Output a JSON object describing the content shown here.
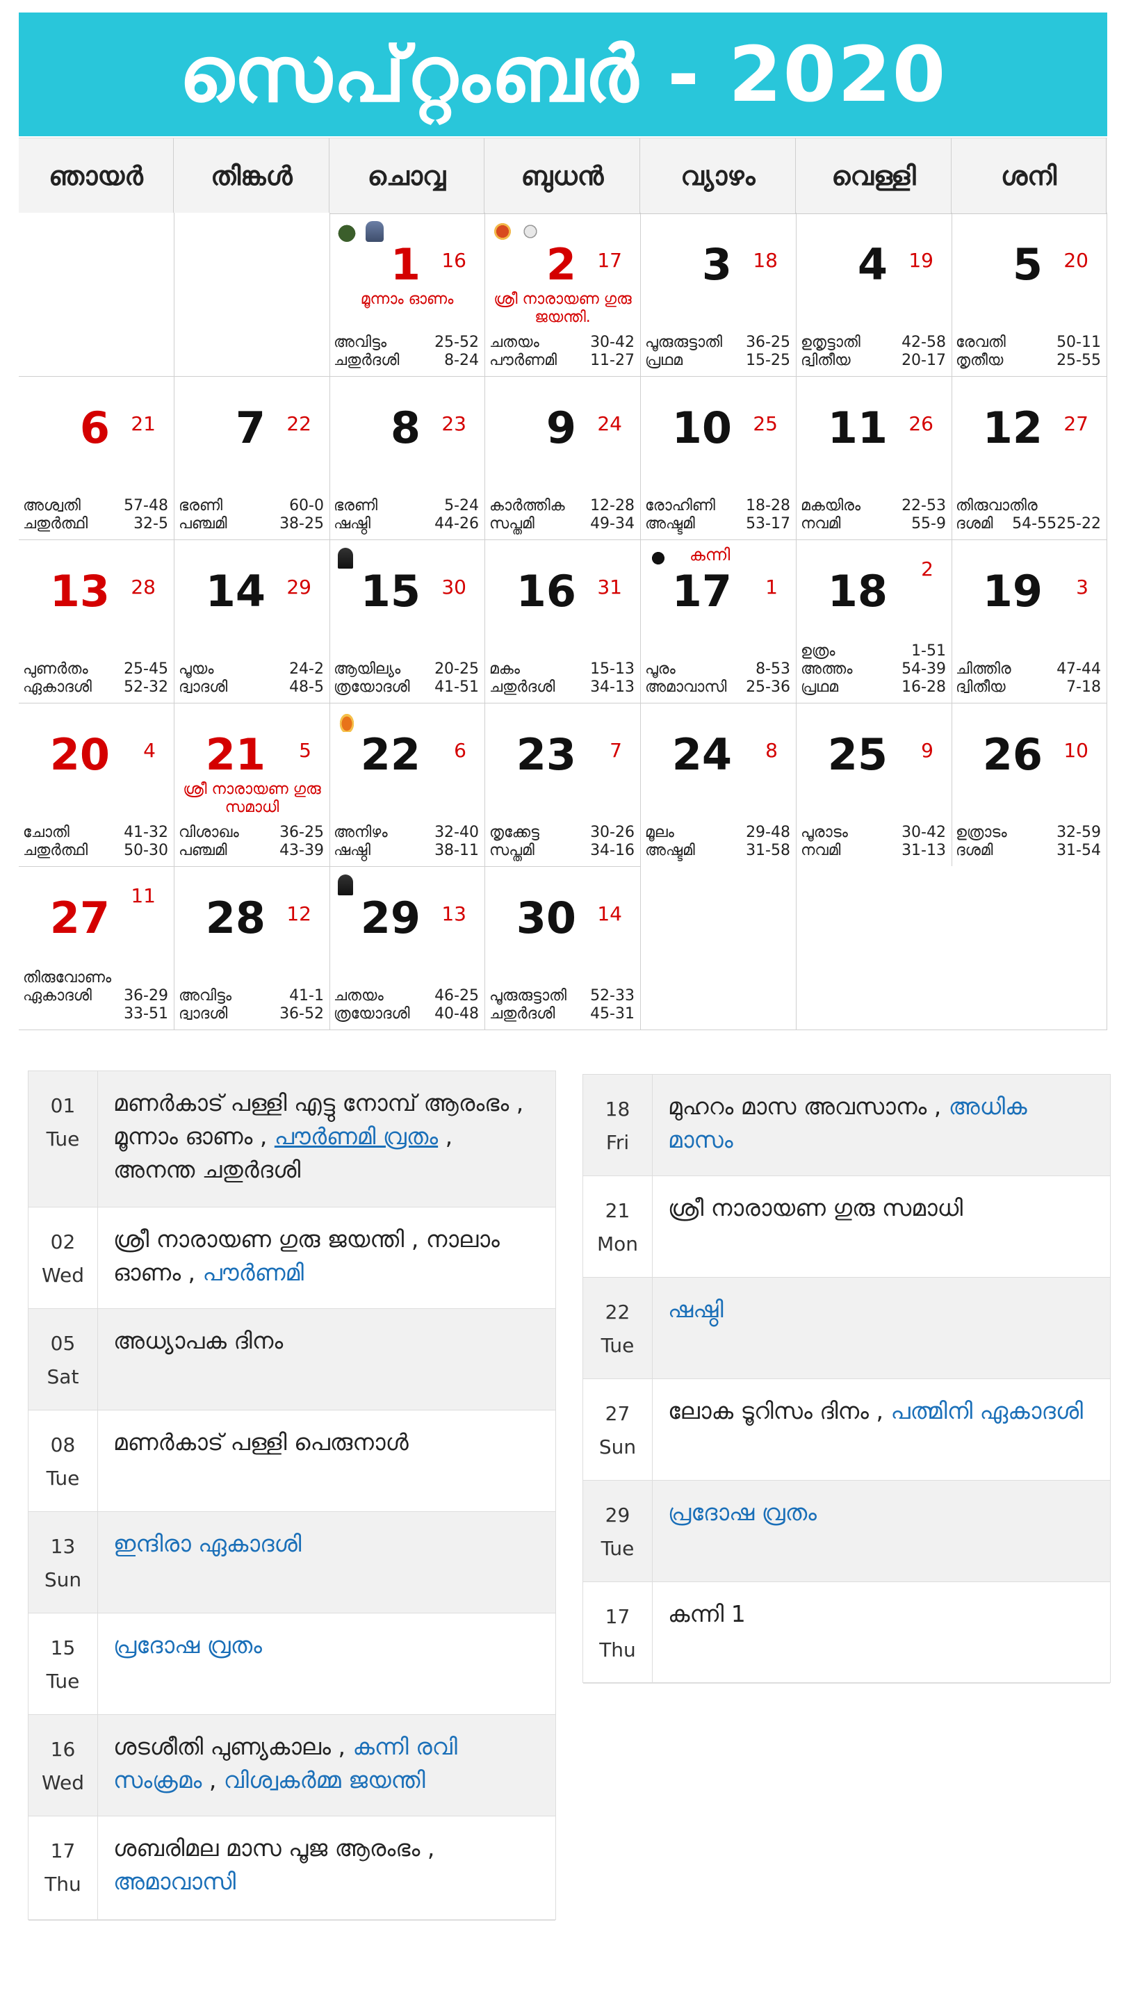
{
  "title": "സെപ്റ്റംബർ - 2020",
  "weekdays": [
    "ഞായർ",
    "തിങ്കൾ",
    "ചൊവ്വ",
    "ബുധൻ",
    "വ്യാഴം",
    "വെള്ളി",
    "ശനി"
  ],
  "days": [
    {
      "d": "1",
      "m": "16",
      "red": true,
      "fest": "മൂന്നാം ഓണം",
      "icons": [
        "pot-icon",
        "deity-icon"
      ],
      "p": [
        [
          "അവിട്ടം",
          "25-52"
        ],
        [
          "ചതുർദശി",
          "8-24"
        ]
      ]
    },
    {
      "d": "2",
      "m": "17",
      "red": true,
      "fest": "ശ്രീ നാരായണ ഗുരു ജയന്തി.",
      "icons": [
        "lamp-icon",
        "full-moon-icon"
      ],
      "p": [
        [
          "ചതയം",
          "30-42"
        ],
        [
          "പൗർണമി",
          "11-27"
        ]
      ]
    },
    {
      "d": "3",
      "m": "18",
      "p": [
        [
          "പൂരുരുട്ടാതി",
          "36-25"
        ],
        [
          "പ്രഥമ",
          "15-25"
        ]
      ]
    },
    {
      "d": "4",
      "m": "19",
      "p": [
        [
          "ഉതൃട്ടാതി",
          "42-58"
        ],
        [
          "ദ്വിതീയ",
          "20-17"
        ]
      ]
    },
    {
      "d": "5",
      "m": "20",
      "p": [
        [
          "രേവതി",
          "50-11"
        ],
        [
          "തൃതീയ",
          "25-55"
        ]
      ]
    },
    {
      "d": "6",
      "m": "21",
      "red": true,
      "p": [
        [
          "അശ്വതി",
          "57-48"
        ],
        [
          "ചതുർത്ഥി",
          "32-5"
        ]
      ]
    },
    {
      "d": "7",
      "m": "22",
      "p": [
        [
          "ഭരണി",
          "60-0"
        ],
        [
          "പഞ്ചമി",
          "38-25"
        ]
      ]
    },
    {
      "d": "8",
      "m": "23",
      "p": [
        [
          "ഭരണി",
          "5-24"
        ],
        [
          "ഷഷ്ഠി",
          "44-26"
        ]
      ]
    },
    {
      "d": "9",
      "m": "24",
      "p": [
        [
          "കാർത്തിക",
          "12-28"
        ],
        [
          "സപ്തമി",
          "49-34"
        ]
      ]
    },
    {
      "d": "10",
      "m": "25",
      "p": [
        [
          "രോഹിണി",
          "18-28"
        ],
        [
          "അഷ്ടമി",
          "53-17"
        ]
      ]
    },
    {
      "d": "11",
      "m": "26",
      "p": [
        [
          "മകയിരം",
          "22-53"
        ],
        [
          "നവമി",
          "55-9"
        ]
      ]
    },
    {
      "d": "12",
      "m": "27",
      "p": [
        [
          "തിരുവാതിര",
          ""
        ],
        [
          "ദശമി",
          "54-5525-22"
        ]
      ]
    },
    {
      "d": "13",
      "m": "28",
      "red": true,
      "p": [
        [
          "പുണർതം",
          "25-45"
        ],
        [
          "ഏകാദശി",
          "52-32"
        ]
      ]
    },
    {
      "d": "14",
      "m": "29",
      "p": [
        [
          "പൂയം",
          "24-2"
        ],
        [
          "ദ്വാദശി",
          "48-5"
        ]
      ]
    },
    {
      "d": "15",
      "m": "30",
      "icons": [
        "shiva-icon"
      ],
      "p": [
        [
          "ആയില്യം",
          "20-25"
        ],
        [
          "ത്രയോദശി",
          "41-51"
        ]
      ]
    },
    {
      "d": "16",
      "m": "31",
      "p": [
        [
          "മകം",
          "15-13"
        ],
        [
          "ചതുർദശി",
          "34-13"
        ]
      ]
    },
    {
      "d": "17",
      "m": "1",
      "festtop": "കന്നി",
      "icons": [
        "new-moon-icon"
      ],
      "p": [
        [
          "പൂരം",
          "8-53"
        ],
        [
          "അമാവാസി",
          "25-36"
        ]
      ]
    },
    {
      "d": "18",
      "m": "2",
      "mup": true,
      "p3": [
        "ഉത്രം",
        "1-51"
      ],
      "p": [
        [
          "അത്തം",
          "54-39"
        ],
        [
          "പ്രഥമ",
          "16-28"
        ]
      ]
    },
    {
      "d": "19",
      "m": "3",
      "p": [
        [
          "ചിത്തിര",
          "47-44"
        ],
        [
          "ദ്വിതീയ",
          "7-18"
        ]
      ]
    },
    {
      "d": "20",
      "m": "4",
      "red": true,
      "p": [
        [
          "ചോതി",
          "41-32"
        ],
        [
          "ചതുർത്ഥി",
          "50-30"
        ]
      ]
    },
    {
      "d": "21",
      "m": "5",
      "red": true,
      "fest": "ശ്രീ നാരായണ ഗുരു സമാധി",
      "p": [
        [
          "വിശാഖം",
          "36-25"
        ],
        [
          "പഞ്ചമി",
          "43-39"
        ]
      ]
    },
    {
      "d": "22",
      "m": "6",
      "icons": [
        "fire-icon"
      ],
      "p": [
        [
          "അനിഴം",
          "32-40"
        ],
        [
          "ഷഷ്ഠി",
          "38-11"
        ]
      ]
    },
    {
      "d": "23",
      "m": "7",
      "p": [
        [
          "തൃക്കേട്ട",
          "30-26"
        ],
        [
          "സപ്തമി",
          "34-16"
        ]
      ]
    },
    {
      "d": "24",
      "m": "8",
      "p": [
        [
          "മൂലം",
          "29-48"
        ],
        [
          "അഷ്ടമി",
          "31-58"
        ]
      ]
    },
    {
      "d": "25",
      "m": "9",
      "p": [
        [
          "പൂരാടം",
          "30-42"
        ],
        [
          "നവമി",
          "31-13"
        ]
      ]
    },
    {
      "d": "26",
      "m": "10",
      "p": [
        [
          "ഉത്രാടം",
          "32-59"
        ],
        [
          "ദശമി",
          "31-54"
        ]
      ]
    },
    {
      "d": "27",
      "m": "11",
      "red": true,
      "mup": true,
      "p3": [
        "തിരുവോണം",
        ""
      ],
      "p": [
        [
          "ഏകാദശി",
          "36-29"
        ],
        [
          "",
          "33-51"
        ]
      ]
    },
    {
      "d": "28",
      "m": "12",
      "p": [
        [
          "അവിട്ടം",
          "41-1"
        ],
        [
          "ദ്വാദശി",
          "36-52"
        ]
      ]
    },
    {
      "d": "29",
      "m": "13",
      "icons": [
        "shiva-icon"
      ],
      "p": [
        [
          "ചതയം",
          "46-25"
        ],
        [
          "ത്രയോദശി",
          "40-48"
        ]
      ]
    },
    {
      "d": "30",
      "m": "14",
      "p": [
        [
          "പൂരുരുട്ടാതി",
          "52-33"
        ],
        [
          "ചതുർദശി",
          "45-31"
        ]
      ]
    }
  ],
  "events_left": [
    {
      "date": "01",
      "day": "Tue",
      "parts": [
        {
          "t": "മണർകാട് പള്ളി എട്ടു നോമ്പ് ആരംഭം , മൂന്നാം ഓണം , "
        },
        {
          "t": "പൗർണമി വ്രതം",
          "link": true,
          "u": true
        },
        {
          "t": " , അനന്ത ചതുർദശി"
        }
      ]
    },
    {
      "date": "02",
      "day": "Wed",
      "parts": [
        {
          "t": "ശ്രീ നാരായണ ഗുരു ജയന്തി , നാലാം ഓണം , "
        },
        {
          "t": "പൗർണമി",
          "link": true
        }
      ]
    },
    {
      "date": "05",
      "day": "Sat",
      "parts": [
        {
          "t": "അധ്യാപക ദിനം"
        }
      ]
    },
    {
      "date": "08",
      "day": "Tue",
      "parts": [
        {
          "t": "മണർകാട് പള്ളി പെരുനാൾ"
        }
      ]
    },
    {
      "date": "13",
      "day": "Sun",
      "parts": [
        {
          "t": "ഇന്ദിരാ ഏകാദശി",
          "link": true
        }
      ]
    },
    {
      "date": "15",
      "day": "Tue",
      "parts": [
        {
          "t": "പ്രദോഷ വ്രതം",
          "link": true
        }
      ]
    },
    {
      "date": "16",
      "day": "Wed",
      "parts": [
        {
          "t": "ശടശീതി പുണ്യകാലം , "
        },
        {
          "t": "കന്നി രവി സംക്രമം",
          "link": true
        },
        {
          "t": " , "
        },
        {
          "t": "വിശ്വകർമ്മ ജയന്തി",
          "link": true
        }
      ]
    },
    {
      "date": "17",
      "day": "Thu",
      "parts": [
        {
          "t": "ശബരിമല മാസ പൂജ ആരംഭം , "
        },
        {
          "t": "അമാവാസി",
          "link": true
        }
      ]
    }
  ],
  "events_right": [
    {
      "date": "18",
      "day": "Fri",
      "parts": [
        {
          "t": "മുഹറം മാസ അവസാനം , "
        },
        {
          "t": "അധിക മാസം",
          "link": true
        }
      ]
    },
    {
      "date": "21",
      "day": "Mon",
      "parts": [
        {
          "t": "ശ്രീ നാരായണ ഗുരു സമാധി"
        }
      ]
    },
    {
      "date": "22",
      "day": "Tue",
      "parts": [
        {
          "t": "ഷഷ്ഠി",
          "link": true
        }
      ]
    },
    {
      "date": "27",
      "day": "Sun",
      "parts": [
        {
          "t": "ലോക ടൂറിസം ദിനം , "
        },
        {
          "t": "പത്മിനി ഏകാദശി",
          "link": true
        }
      ]
    },
    {
      "date": "29",
      "day": "Tue",
      "parts": [
        {
          "t": "പ്രദോഷ വ്രതം",
          "link": true
        }
      ]
    },
    {
      "date": "17",
      "day": "Thu",
      "parts": [
        {
          "t": "കന്നി 1"
        }
      ]
    }
  ]
}
